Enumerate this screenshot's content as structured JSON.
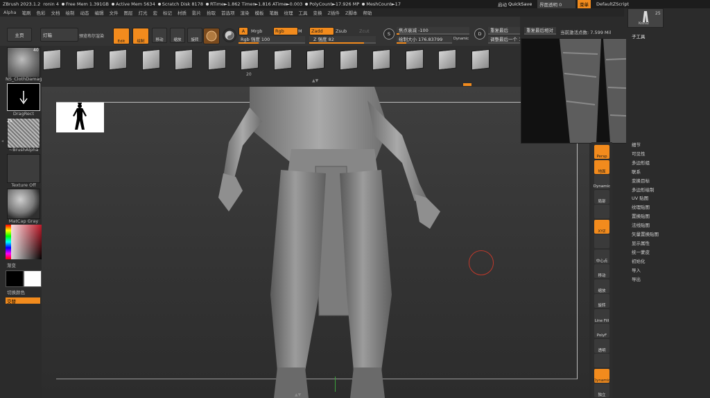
{
  "titlebar": {
    "app": "ZBrush 2023.1.2",
    "user": "ronin 4",
    "free_mem": "Free Mem 1.391GB",
    "active_mem": "Active Mem 5634",
    "scratch": "Scratch Disk 8178",
    "rtime": "RTime►1.862 Timer►1.816 ATime►0.003",
    "polycount": "PolyCount►17.926 MP",
    "meshcount": "MeshCount►17",
    "auto": "启动",
    "quicksave": "QuickSave",
    "transparency": "界面透明 0",
    "menu": "菜单",
    "script": "DefaultZScript"
  },
  "menubar": [
    "Alpha",
    "笔刷",
    "色彩",
    "文档",
    "绘制",
    "动态",
    "编辑",
    "文件",
    "图层",
    "灯光",
    "宏",
    "标记",
    "材质",
    "影片",
    "拾取",
    "首选项",
    "渲染",
    "模板",
    "笔触",
    "纹理",
    "工具",
    "变换",
    "Z插件",
    "Z脚本",
    "帮助"
  ],
  "toolbar": {
    "home": "主页",
    "lightbox": "灯箱",
    "bool_render": "预览布尔渲染",
    "edit": "Edit",
    "draw": "绘制",
    "move": "移动",
    "scale": "缩放",
    "rotate": "旋转",
    "a_label": "A",
    "mrgb": "Mrgb",
    "rgb": "Rgb",
    "m_label": "M",
    "rgb_intensity": "Rgb 强度 100",
    "zadd": "Zadd",
    "zsub": "Zsub",
    "zcut": "Zcut",
    "z_intensity": "Z 强度 82",
    "focal_shift": "焦点衰减 -100",
    "draw_size": "绘制大小 176.83799",
    "dynamic": "Dynamic",
    "s_label": "S",
    "d_label": "D",
    "last_sub": "重复最后",
    "adjust_last": "调整最后一个 1",
    "last_rel": "重复最后相对",
    "active_points": "当前激活点数: 7.599 Mil"
  },
  "alpha_strip": {
    "selected_number": "20",
    "numbers": [
      "",
      "",
      "",
      "",
      "",
      "",
      "20",
      "",
      "",
      "",
      "",
      "",
      "",
      ""
    ]
  },
  "left_tray": {
    "material_badge": "40",
    "material": "NS_ClothDamag",
    "stroke": "DragRect",
    "alpha_badge": "25",
    "alpha": "~BrushAlpha",
    "texture": "Texture Off",
    "matcap": "MatCap Gray",
    "gradient": "渐变",
    "switch_color": "切换颜色",
    "alternate": "交替"
  },
  "right_shelf": [
    "Persp",
    "地面",
    "Dynamic",
    "局部",
    "",
    "XYZ",
    "",
    "中心点",
    "移动",
    "缩放",
    "旋转",
    "Line Fill",
    "PolyF",
    "透明",
    "",
    "Dynamic",
    "独立"
  ],
  "right_panel": {
    "tool_badge": "25",
    "tool_name": "Kozu2",
    "subtool": "子工具",
    "items": [
      "细节",
      "可见性",
      "多边形组",
      "联系",
      "变换目标",
      "多边形绘制",
      "UV 贴图",
      "纹理贴图",
      "置换贴图",
      "法线贴图",
      "矢量置换贴图",
      "显示属性",
      "统一蒙皮",
      "初始化",
      "导入",
      "导出"
    ]
  },
  "colors": {
    "accent": "#f28b1d",
    "primary_color": "#000000",
    "secondary_color": "#ffffff"
  }
}
